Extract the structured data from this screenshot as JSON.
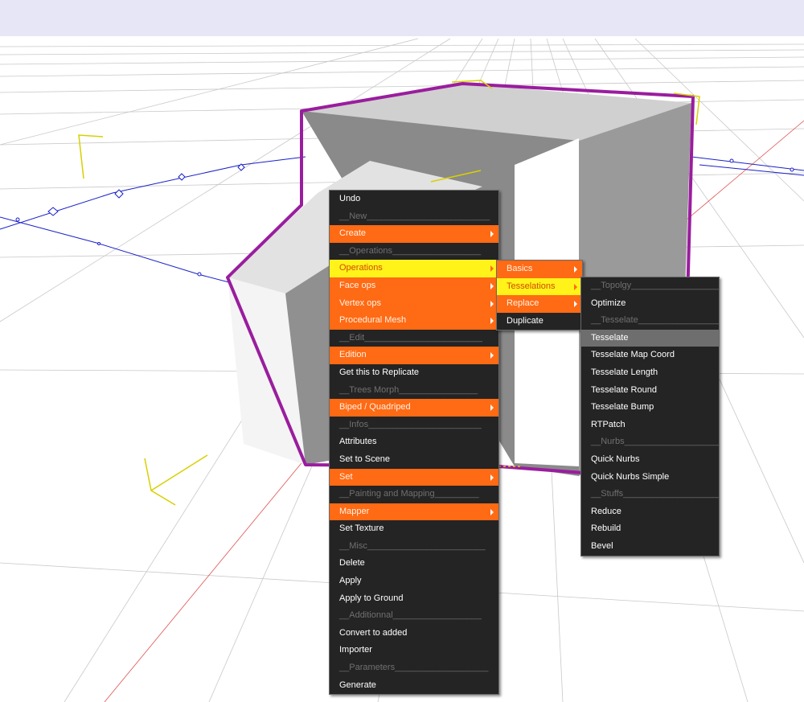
{
  "scene": {
    "background_color": "#e6e6f7",
    "grid_color": "#c8c8c8",
    "selection_color": "#9a1d9e",
    "gizmo_color": "#d8d000",
    "axis_color": "#1a20c8"
  },
  "main_menu": {
    "items": [
      {
        "label": "Undo",
        "kind": "normal",
        "submenu": false
      },
      {
        "label": "__New_________________________",
        "kind": "separator",
        "submenu": false
      },
      {
        "label": "Create",
        "kind": "orange",
        "submenu": true
      },
      {
        "label": "__Operations__________________",
        "kind": "separator",
        "submenu": false
      },
      {
        "label": "Operations",
        "kind": "yellow",
        "submenu": true
      },
      {
        "label": "Face ops",
        "kind": "orange",
        "submenu": true
      },
      {
        "label": "Vertex ops",
        "kind": "orange",
        "submenu": true
      },
      {
        "label": "Procedural Mesh",
        "kind": "orange",
        "submenu": true
      },
      {
        "label": "__Edit________________________",
        "kind": "separator",
        "submenu": false
      },
      {
        "label": "Edition",
        "kind": "orange",
        "submenu": true
      },
      {
        "label": "Get this to Replicate",
        "kind": "normal",
        "submenu": false
      },
      {
        "label": "__Trees Morph________________",
        "kind": "separator",
        "submenu": false
      },
      {
        "label": "Biped / Quadriped",
        "kind": "orange",
        "submenu": true
      },
      {
        "label": "__Infos_______________________",
        "kind": "separator",
        "submenu": false
      },
      {
        "label": "Attributes",
        "kind": "normal",
        "submenu": false
      },
      {
        "label": "Set to Scene",
        "kind": "normal",
        "submenu": false
      },
      {
        "label": "Set",
        "kind": "orange",
        "submenu": true
      },
      {
        "label": "__Painting and Mapping_________",
        "kind": "separator",
        "submenu": false
      },
      {
        "label": "Mapper",
        "kind": "orange",
        "submenu": true
      },
      {
        "label": "Set Texture",
        "kind": "normal",
        "submenu": false
      },
      {
        "label": "__Misc________________________",
        "kind": "separator",
        "submenu": false
      },
      {
        "label": "Delete",
        "kind": "normal",
        "submenu": false
      },
      {
        "label": "Apply",
        "kind": "normal",
        "submenu": false
      },
      {
        "label": "Apply to Ground",
        "kind": "normal",
        "submenu": false
      },
      {
        "label": "__Additionnal__________________",
        "kind": "separator",
        "submenu": false
      },
      {
        "label": "Convert to added",
        "kind": "normal",
        "submenu": false
      },
      {
        "label": "Importer",
        "kind": "normal",
        "submenu": false
      },
      {
        "label": "__Parameters___________________",
        "kind": "separator",
        "submenu": false
      },
      {
        "label": "Generate",
        "kind": "normal",
        "submenu": false
      }
    ]
  },
  "operations_menu": {
    "items": [
      {
        "label": "Basics",
        "kind": "orange",
        "submenu": true
      },
      {
        "label": "Tesselations",
        "kind": "yellow",
        "submenu": true
      },
      {
        "label": "Replace",
        "kind": "orange",
        "submenu": true
      },
      {
        "label": "Duplicate",
        "kind": "normal",
        "submenu": false
      }
    ]
  },
  "tesselations_menu": {
    "items": [
      {
        "label": "__Topolgy__________________",
        "kind": "separator",
        "submenu": false
      },
      {
        "label": "Optimize",
        "kind": "normal",
        "submenu": false
      },
      {
        "label": "__Tesselate_________________",
        "kind": "separator",
        "submenu": false
      },
      {
        "label": "Tesselate",
        "kind": "hl",
        "submenu": false
      },
      {
        "label": "Tesselate Map Coord",
        "kind": "normal",
        "submenu": false
      },
      {
        "label": "Tesselate Length",
        "kind": "normal",
        "submenu": false
      },
      {
        "label": "Tesselate Round",
        "kind": "normal",
        "submenu": false
      },
      {
        "label": "Tesselate Bump",
        "kind": "normal",
        "submenu": false
      },
      {
        "label": "RTPatch",
        "kind": "normal",
        "submenu": false
      },
      {
        "label": "__Nurbs____________________",
        "kind": "separator",
        "submenu": false
      },
      {
        "label": "Quick Nurbs",
        "kind": "normal",
        "submenu": false
      },
      {
        "label": "Quick Nurbs Simple",
        "kind": "normal",
        "submenu": false
      },
      {
        "label": "__Stuffs____________________",
        "kind": "separator",
        "submenu": false
      },
      {
        "label": "Reduce",
        "kind": "normal",
        "submenu": false
      },
      {
        "label": "Rebuild",
        "kind": "normal",
        "submenu": false
      },
      {
        "label": "Bevel",
        "kind": "normal",
        "submenu": false
      }
    ]
  }
}
